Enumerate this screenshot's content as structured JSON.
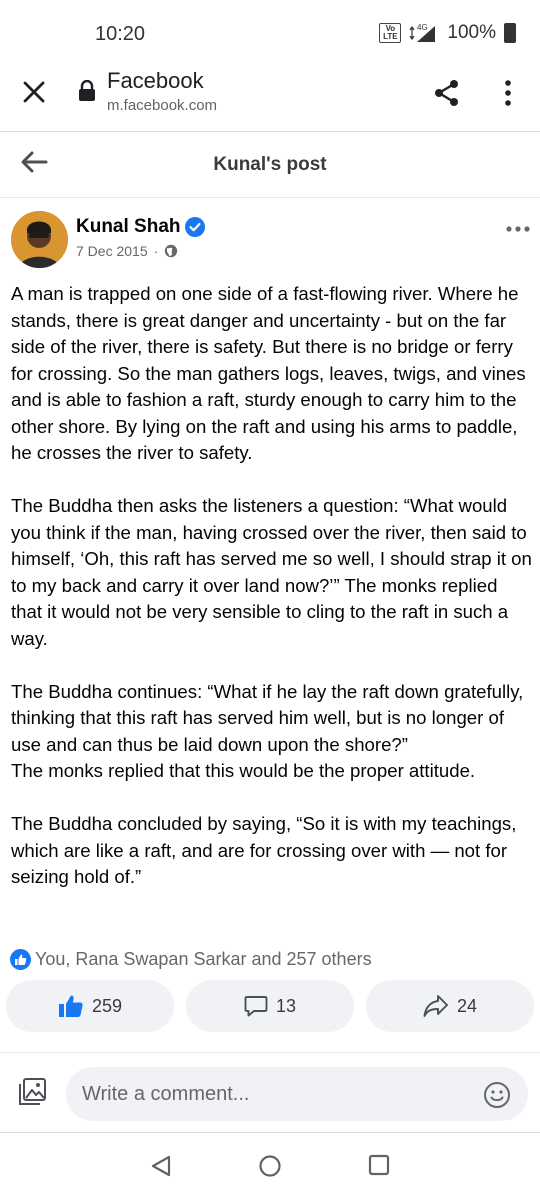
{
  "status": {
    "time": "10:20",
    "network": "4G",
    "volte": "Vo LTE",
    "battery": "100%"
  },
  "browser": {
    "title": "Facebook",
    "url": "m.facebook.com"
  },
  "header": {
    "title": "Kunal's post"
  },
  "post": {
    "author": "Kunal Shah",
    "date": "7 Dec 2015",
    "date_separator": "·",
    "paragraphs": [
      "A man is trapped on one side of a fast-flowing river. Where he stands, there is great danger and uncertainty - but on the far side of the river, there is safety. But there is no bridge or ferry for crossing. So the man gathers logs, leaves, twigs, and vines and is able to fashion a raft, sturdy enough to carry him to the other shore. By lying on the raft and using his arms to paddle, he crosses the river to safety.",
      "The Buddha then asks the listeners a question: “What would you think if the man, having crossed over the river, then said to himself, ‘Oh, this raft has served me so well, I should strap it on to my back and carry it over land now?’” The monks replied that it would not be very sensible to cling to the raft in such a way.",
      "The Buddha continues: “What if he lay the raft down gratefully, thinking that this raft has served him well, but is no longer of use and can thus be laid down upon the shore?”\nThe monks replied that this would be the proper attitude.",
      "The Buddha concluded by saying, “So it is with my teachings, which are like a raft, and are for crossing over with — not for seizing hold of.”"
    ],
    "reactions_text": "You, Rana Swapan Sarkar and 257 others",
    "like_count": "259",
    "comment_count": "13",
    "share_count": "24"
  },
  "comment": {
    "placeholder": "Write a comment..."
  },
  "colors": {
    "brand_blue": "#1877f2",
    "pill_bg": "#f0f2f5",
    "text": "#050505",
    "muted": "#65676b"
  },
  "icons": [
    "close-icon",
    "lock-icon",
    "share-icon",
    "more-vert-icon",
    "back-arrow-icon",
    "verified-icon",
    "globe-icon",
    "more-horiz-icon",
    "like-icon",
    "comment-icon",
    "share-arrow-icon",
    "gallery-icon",
    "emoji-icon",
    "nav-back-icon",
    "nav-home-icon",
    "nav-recents-icon"
  ]
}
